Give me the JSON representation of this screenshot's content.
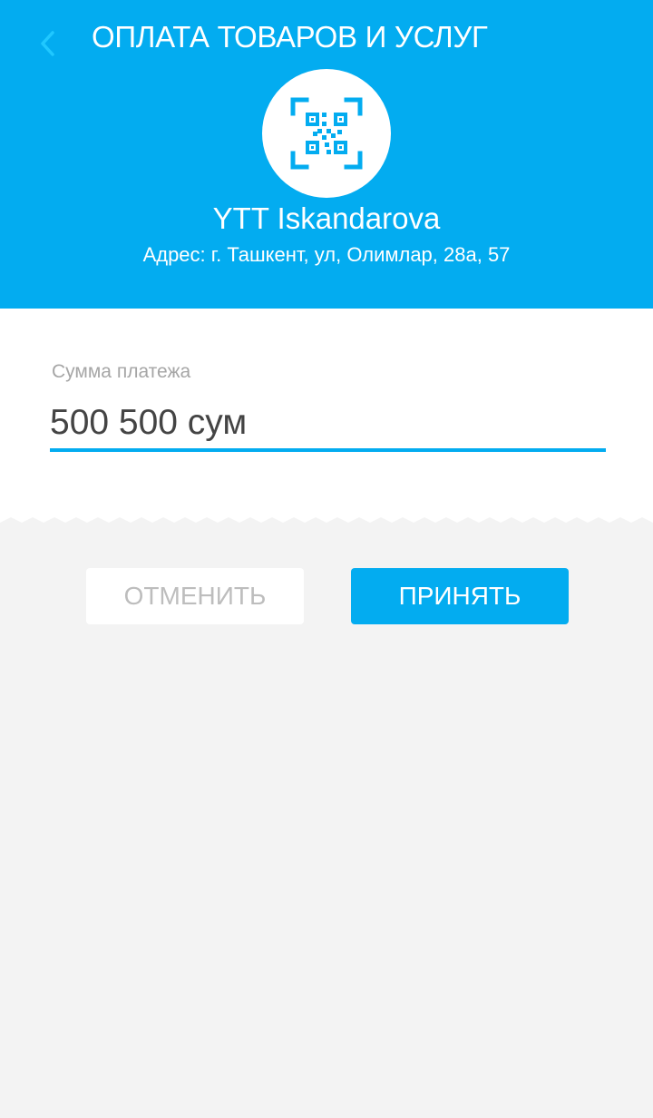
{
  "header": {
    "title": "ОПЛАТА ТОВАРОВ И УСЛУГ",
    "back_icon": "chevron-left-icon",
    "qr_icon": "qr-code-scan-icon"
  },
  "merchant": {
    "name": "YTT Iskandarova",
    "address": "Адрес: г. Ташкент, ул, Олимлар, 28а, 57"
  },
  "payment": {
    "label": "Сумма платежа",
    "amount_value": "500 500 сум"
  },
  "actions": {
    "cancel_label": "ОТМЕНИТЬ",
    "accept_label": "ПРИНЯТЬ"
  },
  "colors": {
    "accent": "#03acf0",
    "background": "#f3f3f3",
    "card": "#ffffff"
  }
}
